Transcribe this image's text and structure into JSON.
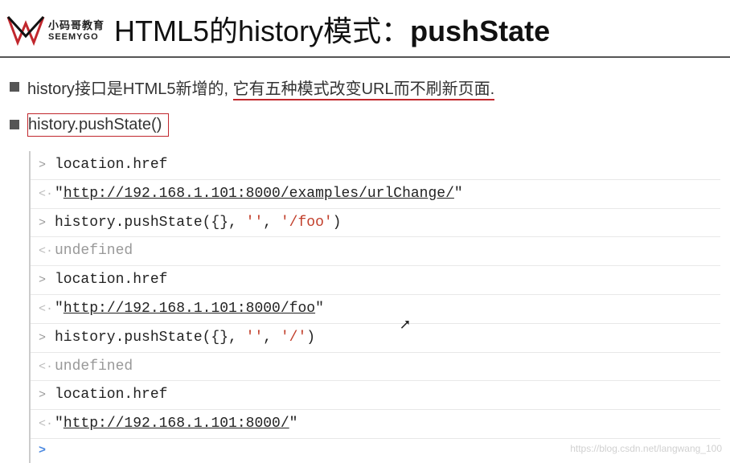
{
  "logo": {
    "cn": "小码哥教育",
    "en": "SEEMYGO"
  },
  "title_prefix": "HTML5的history模式：",
  "title_bold": "pushState",
  "bullets": {
    "line1_plain": "history接口是HTML5新增的, ",
    "line1_underlined": "它有五种模式改变URL而不刷新页面.",
    "line2": "history.pushState()"
  },
  "console": {
    "rows": [
      {
        "dir": "in",
        "text": "location.href"
      },
      {
        "dir": "out",
        "quote_open": "\"",
        "link": "http://192.168.1.101:8000/examples/urlChange/",
        "quote_close": "\""
      },
      {
        "dir": "in",
        "text_pre": "history.pushState({}, ",
        "str1": "''",
        "sep": ", ",
        "str2": "'/foo'",
        "text_post": ")"
      },
      {
        "dir": "out",
        "undef": "undefined"
      },
      {
        "dir": "in",
        "text": "location.href"
      },
      {
        "dir": "out",
        "quote_open": "\"",
        "link": "http://192.168.1.101:8000/foo",
        "quote_close": "\""
      },
      {
        "dir": "in",
        "text_pre": "history.pushState({}, ",
        "str1": "''",
        "sep": ", ",
        "str2": "'/'",
        "text_post": ")"
      },
      {
        "dir": "out",
        "undef": "undefined"
      },
      {
        "dir": "in",
        "text": "location.href"
      },
      {
        "dir": "out",
        "quote_open": "\"",
        "link": "http://192.168.1.101:8000/",
        "quote_close": "\""
      },
      {
        "dir": "prompt",
        "text": ""
      }
    ]
  },
  "arrows": {
    "in": ">",
    "out": "<·",
    "prompt": ">"
  },
  "watermark": "https://blog.csdn.net/langwang_100"
}
